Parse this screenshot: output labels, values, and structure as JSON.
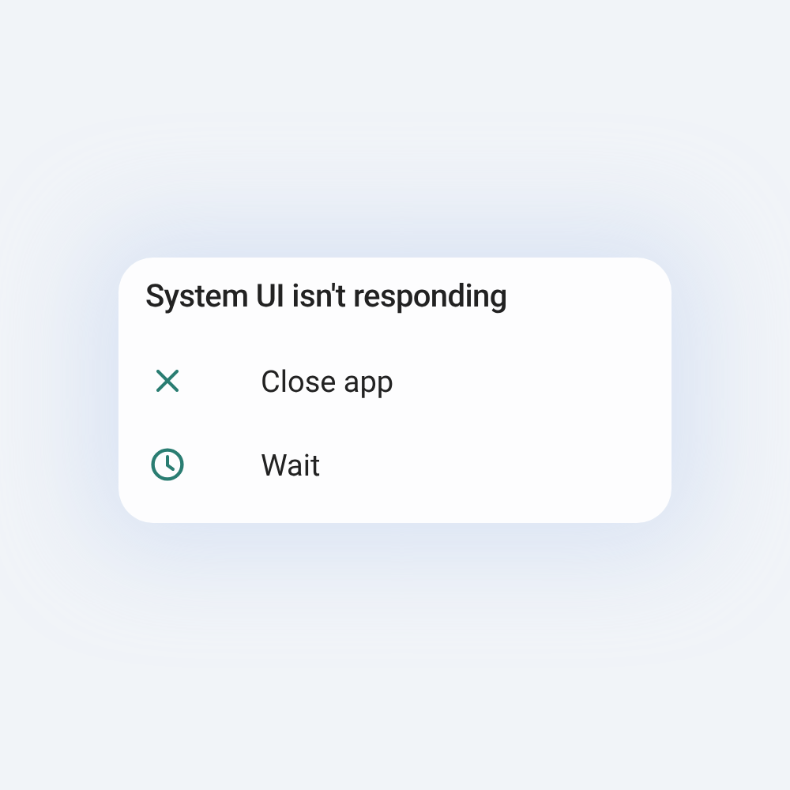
{
  "dialog": {
    "title": "System UI isn't responding",
    "options": [
      {
        "kind": "close",
        "label": "Close app"
      },
      {
        "kind": "wait",
        "label": "Wait"
      }
    ]
  }
}
